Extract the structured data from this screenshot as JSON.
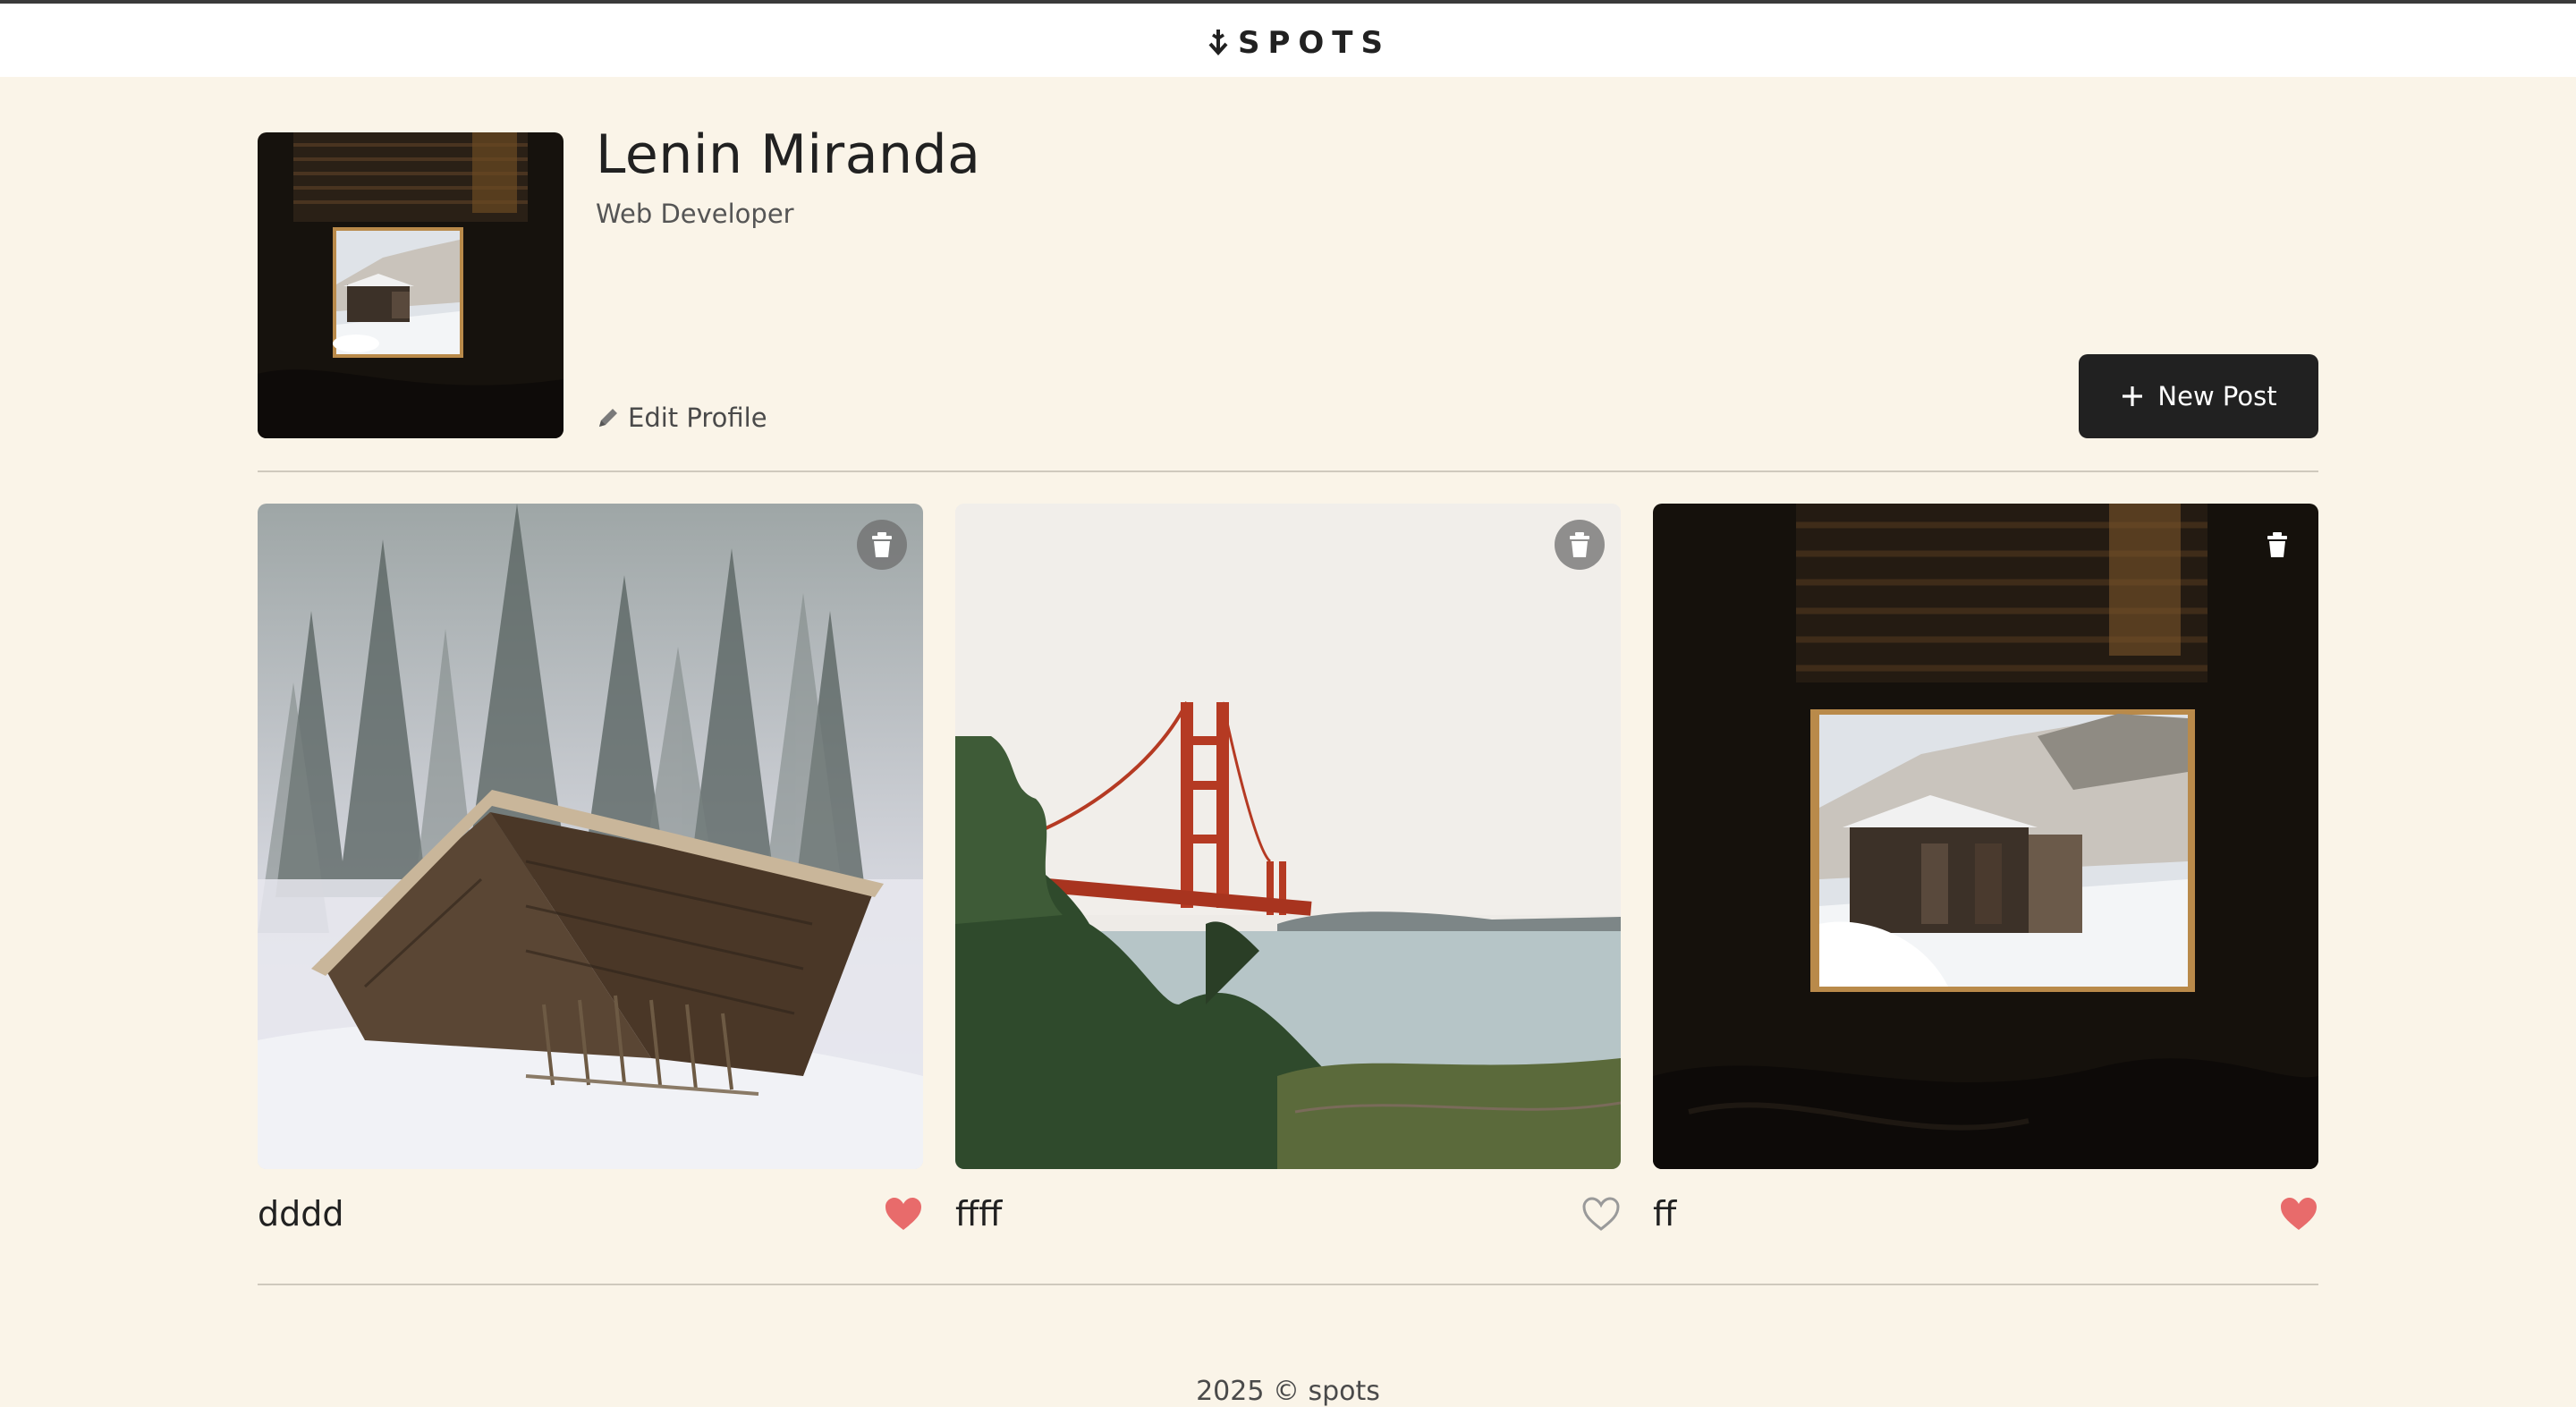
{
  "header": {
    "logo_text": "SPOTS"
  },
  "profile": {
    "name": "Lenin Miranda",
    "description": "Web Developer",
    "edit_label": "Edit Profile",
    "new_post_label": "New Post"
  },
  "cards": [
    {
      "title": "dddd",
      "liked": true
    },
    {
      "title": "ffff",
      "liked": false
    },
    {
      "title": "ff",
      "liked": true
    }
  ],
  "footer": {
    "text": "2025 © spots"
  },
  "colors": {
    "background": "#FAF4E8",
    "dark": "#212121",
    "like": "#E86B6B"
  }
}
